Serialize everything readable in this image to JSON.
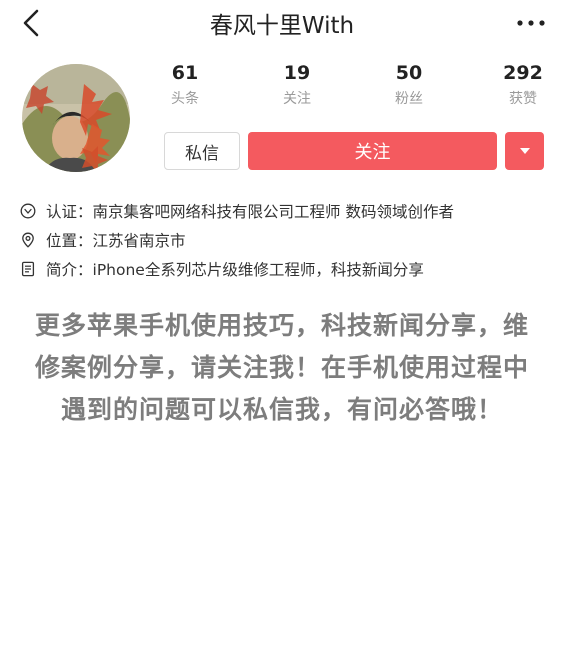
{
  "header": {
    "title": "春风十里With",
    "back_icon": "chevron-left-icon",
    "more_icon": "more-dots-icon"
  },
  "stats": [
    {
      "value": "61",
      "label": "头条"
    },
    {
      "value": "19",
      "label": "关注"
    },
    {
      "value": "50",
      "label": "粉丝"
    },
    {
      "value": "292",
      "label": "获赞"
    }
  ],
  "actions": {
    "message_label": "私信",
    "follow_label": "关注",
    "dropdown_icon": "caret-down-icon",
    "follow_color": "#f45a5f"
  },
  "profile": {
    "cert_key": "认证：",
    "cert_value": "南京集客吧网络科技有限公司工程师 数码领域创作者",
    "location_key": "位置：",
    "location_value": "江苏省南京市",
    "bio_key": "简介：",
    "bio_value": "iPhone全系列芯片级维修工程师，科技新闻分享"
  },
  "overlay_text": {
    "line1": "更多苹果手机使用技巧，科技新闻分享，维",
    "line2": "修案例分享，请关注我！在手机使用过程中",
    "line3": "遇到的问题可以私信我，有问必答哦！"
  }
}
